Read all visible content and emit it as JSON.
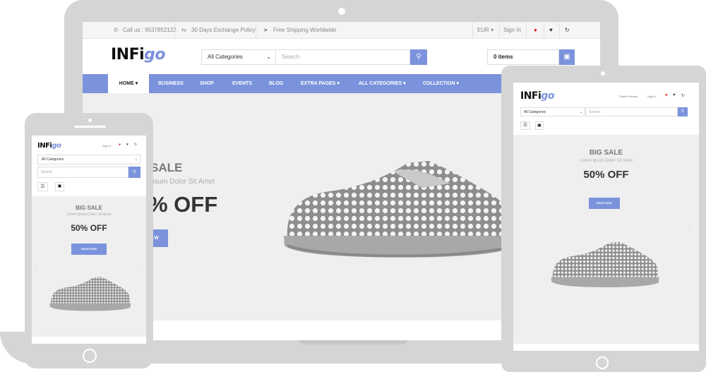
{
  "topbar": {
    "call": "Call us : 9537852122",
    "exchange": "30 Days Exchange Policy",
    "shipping": "Free Shipping Worldwide",
    "currency": "EUR",
    "signin": "Sign In"
  },
  "brand": {
    "logo_main": "INFi",
    "logo_go": "go"
  },
  "search": {
    "category": "All Categories",
    "placeholder": "Search"
  },
  "cart": {
    "label": "0 items"
  },
  "nav": {
    "items": [
      "HOME",
      "BUSINESS",
      "SHOP",
      "EVENTS",
      "BLOG",
      "EXTRA PAGES",
      "ALL CATEGORIES",
      "COLLECTION"
    ]
  },
  "banner": {
    "title": "BIG SALE",
    "subtitle": "Lorem Ipsum Dolor Sit Amet",
    "offer": "50% OFF",
    "button": "SHOP NOW",
    "laptop_title_crop": "SALE",
    "laptop_sub_crop": "psum Dolor Sit Amet",
    "laptop_offer_crop": "% OFF",
    "laptop_btn_crop": "W"
  },
  "tablet": {
    "lang": "Public Preview",
    "signin": "Sign In"
  },
  "phone": {
    "signin": "Sign In"
  },
  "colors": {
    "accent": "#7b93dc",
    "device": "#d5d5d5",
    "banner_bg": "#efefef"
  },
  "icons": [
    "phone-icon",
    "exchange-icon",
    "plane-icon",
    "bell-icon",
    "heart-icon",
    "refresh-icon",
    "search-icon",
    "bag-icon",
    "menu-icon",
    "chevron-down-icon"
  ]
}
